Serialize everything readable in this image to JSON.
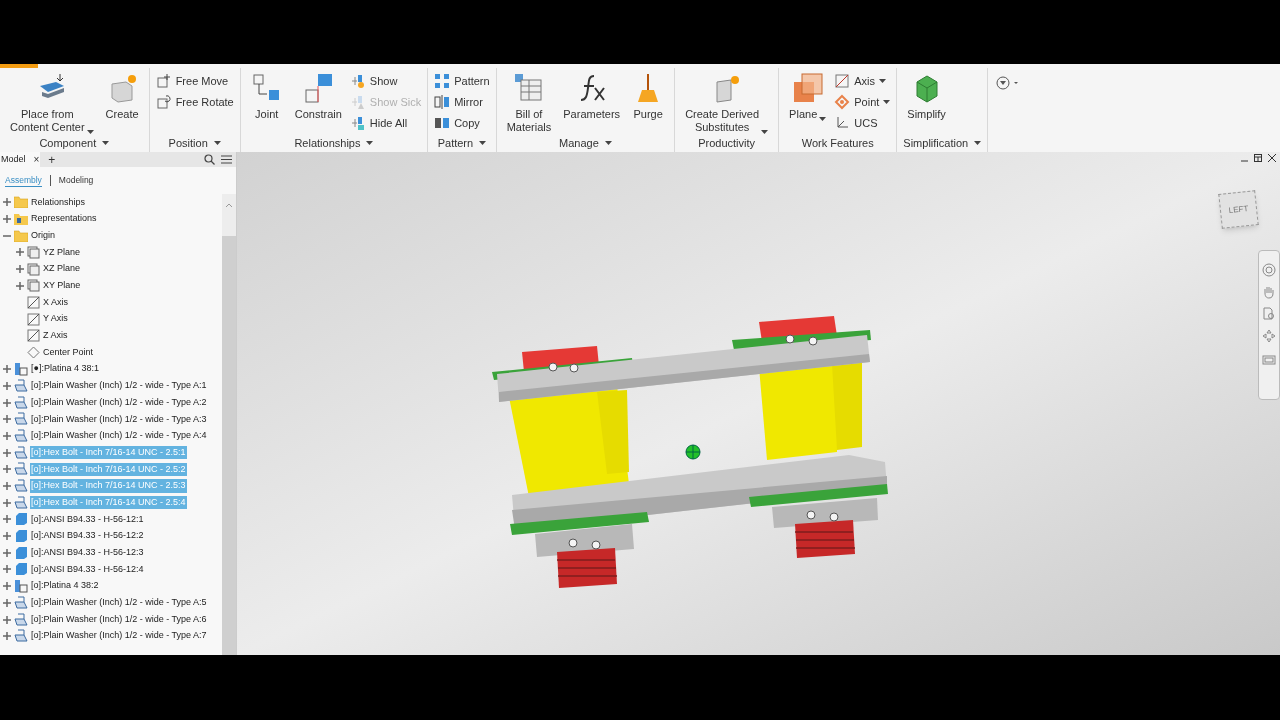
{
  "ribbon": {
    "groups": [
      {
        "label": "Component",
        "has_menu": true,
        "tools": [
          {
            "kind": "large",
            "label": "Place from\nContent Center",
            "menu": true,
            "disabled": false
          },
          {
            "kind": "large",
            "label": "Create",
            "menu": false,
            "disabled": false
          }
        ]
      },
      {
        "label": "Position",
        "has_menu": true,
        "tools": [
          {
            "kind": "small",
            "label": "Free Move",
            "menu": false,
            "disabled": false
          },
          {
            "kind": "small",
            "label": "Free Rotate",
            "menu": false,
            "disabled": false
          }
        ]
      },
      {
        "label": "Relationships",
        "has_menu": true,
        "tools": [
          {
            "kind": "large",
            "label": "Joint",
            "menu": false,
            "disabled": false
          },
          {
            "kind": "large",
            "label": "Constrain",
            "menu": false,
            "disabled": false
          },
          {
            "kind": "small",
            "label": "Show",
            "menu": false,
            "disabled": false
          },
          {
            "kind": "small",
            "label": "Show Sick",
            "menu": false,
            "disabled": true
          },
          {
            "kind": "small",
            "label": "Hide All",
            "menu": false,
            "disabled": false
          }
        ]
      },
      {
        "label": "Pattern",
        "has_menu": true,
        "tools": [
          {
            "kind": "small",
            "label": "Pattern",
            "menu": false,
            "disabled": false
          },
          {
            "kind": "small",
            "label": "Mirror",
            "menu": false,
            "disabled": false
          },
          {
            "kind": "small",
            "label": "Copy",
            "menu": false,
            "disabled": false
          }
        ]
      },
      {
        "label": "Manage",
        "has_menu": true,
        "tools": [
          {
            "kind": "large",
            "label": "Bill of\nMaterials",
            "menu": false,
            "disabled": false
          },
          {
            "kind": "large",
            "label": "Parameters",
            "menu": false,
            "disabled": false
          },
          {
            "kind": "large",
            "label": "Purge",
            "menu": false,
            "disabled": false
          }
        ]
      },
      {
        "label": "Productivity",
        "has_menu": false,
        "tools": [
          {
            "kind": "large",
            "label": "Create Derived\nSubstitutes",
            "menu": true,
            "disabled": false
          }
        ]
      },
      {
        "label": "Work Features",
        "has_menu": false,
        "tools": [
          {
            "kind": "large",
            "label": "Plane",
            "menu": true,
            "disabled": false
          },
          {
            "kind": "small",
            "label": "Axis",
            "menu": true,
            "disabled": false
          },
          {
            "kind": "small",
            "label": "Point",
            "menu": true,
            "disabled": false
          },
          {
            "kind": "small",
            "label": "UCS",
            "menu": false,
            "disabled": false
          }
        ]
      },
      {
        "label": "Simplification",
        "has_menu": true,
        "tools": [
          {
            "kind": "large",
            "label": "Simplify",
            "menu": false,
            "disabled": false
          }
        ]
      }
    ]
  },
  "browser": {
    "tab": {
      "label": "Model",
      "close": "×"
    },
    "add": "+",
    "subtabs": [
      {
        "label": "Assembly",
        "selected": true
      },
      {
        "label": "Modeling",
        "selected": false
      }
    ],
    "tree": [
      {
        "label": "Relationships",
        "kind": "folder",
        "expanded": false,
        "selected": false
      },
      {
        "label": "Representations",
        "kind": "representations",
        "expanded": false,
        "selected": false
      },
      {
        "label": "Origin",
        "kind": "folder",
        "expanded": true,
        "selected": false,
        "children": [
          {
            "label": "YZ Plane",
            "kind": "plane",
            "expanded": false,
            "selected": false
          },
          {
            "label": "XZ Plane",
            "kind": "plane",
            "expanded": false,
            "selected": false
          },
          {
            "label": "XY Plane",
            "kind": "plane",
            "expanded": false,
            "selected": false
          },
          {
            "label": "X Axis",
            "kind": "axis",
            "selected": false
          },
          {
            "label": "Y Axis",
            "kind": "axis",
            "selected": false
          },
          {
            "label": "Z Axis",
            "kind": "axis",
            "selected": false
          },
          {
            "label": "Center Point",
            "kind": "point",
            "selected": false
          }
        ]
      },
      {
        "label": "[●]:Platina 4 38:1",
        "kind": "assembly",
        "expanded": false,
        "selected": false
      },
      {
        "label": "[o]:Plain Washer (Inch) 1/2 - wide - Type A:1",
        "kind": "part",
        "expanded": false,
        "selected": false
      },
      {
        "label": "[o]:Plain Washer (Inch) 1/2 - wide - Type A:2",
        "kind": "part",
        "expanded": false,
        "selected": false
      },
      {
        "label": "[o]:Plain Washer (Inch) 1/2 - wide - Type A:3",
        "kind": "part",
        "expanded": false,
        "selected": false
      },
      {
        "label": "[o]:Plain Washer (Inch) 1/2 - wide - Type A:4",
        "kind": "part",
        "expanded": false,
        "selected": false
      },
      {
        "label": "[o]:Hex Bolt - Inch 7/16-14 UNC - 2.5:1",
        "kind": "part",
        "expanded": false,
        "selected": true
      },
      {
        "label": "[o]:Hex Bolt - Inch 7/16-14 UNC - 2.5:2",
        "kind": "part",
        "expanded": false,
        "selected": true
      },
      {
        "label": "[o]:Hex Bolt - Inch 7/16-14 UNC - 2.5:3",
        "kind": "part",
        "expanded": false,
        "selected": true
      },
      {
        "label": "[o]:Hex Bolt - Inch 7/16-14 UNC - 2.5:4",
        "kind": "part",
        "expanded": false,
        "selected": true
      },
      {
        "label": "[o]:ANSI B94.33 - H-56-12:1",
        "kind": "solid",
        "expanded": false,
        "selected": false
      },
      {
        "label": "[o]:ANSI B94.33 - H-56-12:2",
        "kind": "solid",
        "expanded": false,
        "selected": false
      },
      {
        "label": "[o]:ANSI B94.33 - H-56-12:3",
        "kind": "solid",
        "expanded": false,
        "selected": false
      },
      {
        "label": "[o]:ANSI B94.33 - H-56-12:4",
        "kind": "solid",
        "expanded": false,
        "selected": false
      },
      {
        "label": "[o]:Platina 4 38:2",
        "kind": "assembly",
        "expanded": false,
        "selected": false
      },
      {
        "label": "[o]:Plain Washer (Inch) 1/2 - wide - Type A:5",
        "kind": "part",
        "expanded": false,
        "selected": false
      },
      {
        "label": "[o]:Plain Washer (Inch) 1/2 - wide - Type A:6",
        "kind": "part",
        "expanded": false,
        "selected": false
      },
      {
        "label": "[o]:Plain Washer (Inch) 1/2 - wide - Type A:7",
        "kind": "part",
        "expanded": false,
        "selected": false
      }
    ]
  },
  "viewport": {
    "view_cube": "LEFT"
  }
}
